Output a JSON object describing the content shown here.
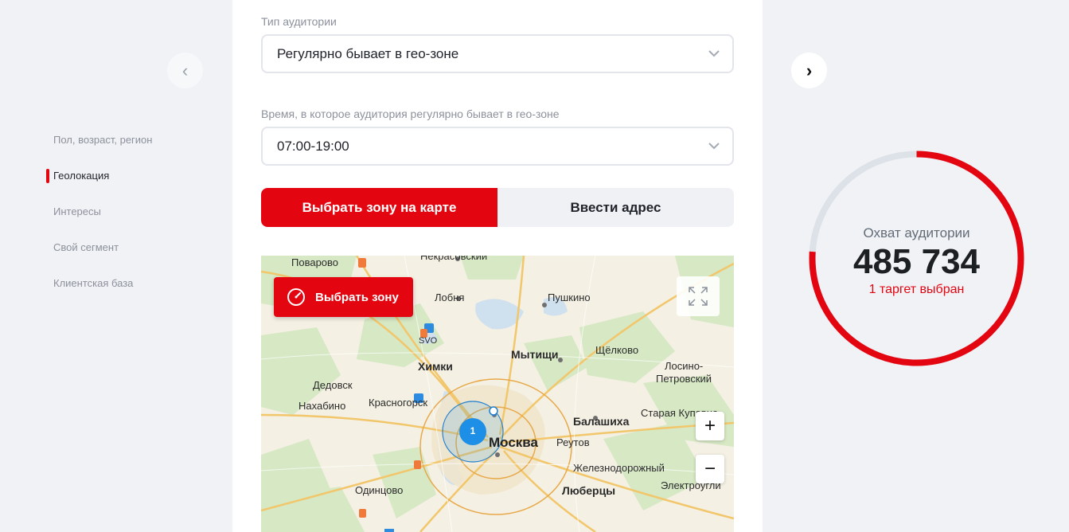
{
  "nav": {
    "prev_glyph": "‹",
    "next_glyph": "›"
  },
  "sidebar": {
    "items": [
      {
        "label": "Пол, возраст, регион",
        "active": false
      },
      {
        "label": "Геолокация",
        "active": true
      },
      {
        "label": "Интересы",
        "active": false
      },
      {
        "label": "Свой сегмент",
        "active": false
      },
      {
        "label": "Клиентская база",
        "active": false
      }
    ]
  },
  "form": {
    "audience_type_label": "Тип аудитории",
    "audience_type_value": "Регулярно бывает в гео-зоне",
    "time_label": "Время, в которое аудитория регулярно бывает в гео-зоне",
    "time_value": "07:00-19:00",
    "mode_map": "Выбрать зону на карте",
    "mode_address": "Ввести адрес"
  },
  "map": {
    "select_zone_label": "Выбрать зону",
    "zoom_in": "+",
    "zoom_out": "−",
    "marker_count": "1",
    "labels": {
      "povarovo": "Поварово",
      "nekrasovsky": "Некрасовский",
      "lobnya": "Лобня",
      "pushkino": "Пушкино",
      "svo": "SVO",
      "mytishchi": "Мытищи",
      "shchelkovo": "Щёлково",
      "khimki": "Химки",
      "losino": "Лосино-",
      "petrovsky": "Петровский",
      "dedovsk": "Дедовск",
      "krasnogorsk": "Красногорск",
      "nakhabino": "Нахабино",
      "balashikha": "Балашиха",
      "staraya": "Старая Купавна",
      "moskva": "Москва",
      "reutov": "Реутов",
      "zheleznodorozhny": "Железнодорожный",
      "odintsovo": "Одинцово",
      "lyubertsy": "Люберцы",
      "elektrougli": "Электроугли"
    }
  },
  "reach": {
    "title": "Охват аудитории",
    "value": "485 734",
    "subtitle": "1 таргет выбран",
    "fraction": 0.76,
    "accent": "#e30611",
    "track": "#dde2e8"
  }
}
